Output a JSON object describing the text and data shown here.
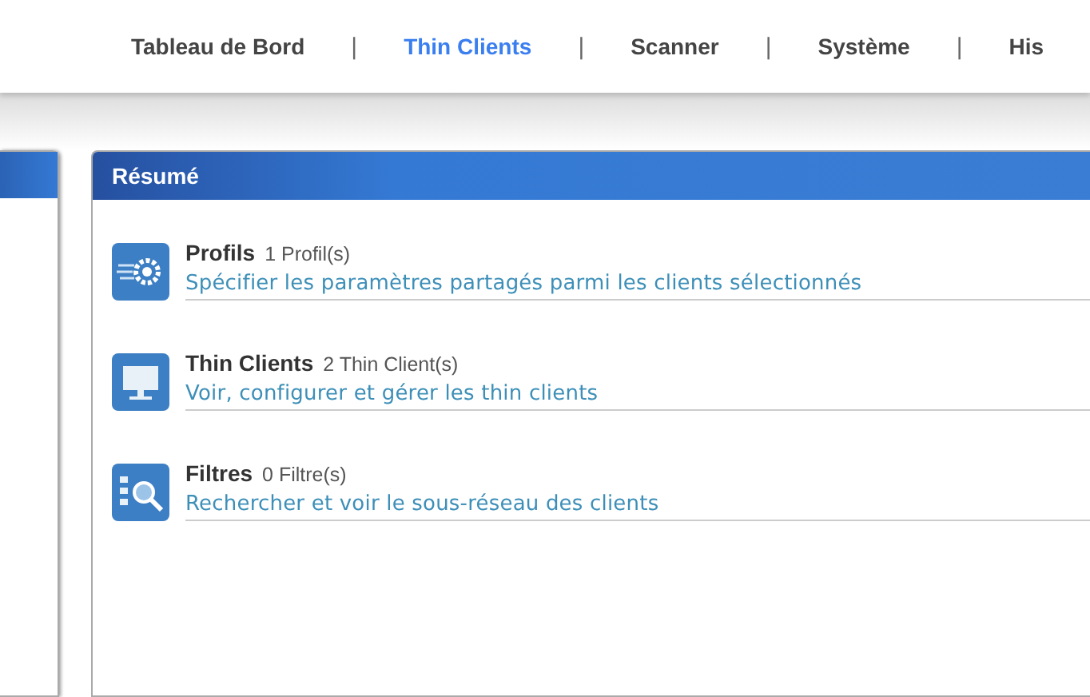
{
  "nav": [
    {
      "label": "Tableau de Bord",
      "selected": false
    },
    {
      "label": "Thin Clients",
      "selected": true
    },
    {
      "label": "Scanner",
      "selected": false
    },
    {
      "label": "Système",
      "selected": false
    },
    {
      "label": "His",
      "selected": false
    }
  ],
  "nav_separator": "|",
  "summary": {
    "title": "Résumé",
    "items": [
      {
        "kind": "gear",
        "title": "Profils",
        "count": "1 Profil(s)",
        "link": "Spécifier les paramètres partagés parmi les clients sélectionnés"
      },
      {
        "kind": "monitor",
        "title": "Thin Clients",
        "count": "2 Thin Client(s)",
        "link": "Voir, configurer et gérer les thin clients"
      },
      {
        "kind": "search",
        "title": "Filtres",
        "count": "0 Filtre(s)",
        "link": "Rechercher et voir le sous-réseau des clients"
      }
    ]
  }
}
